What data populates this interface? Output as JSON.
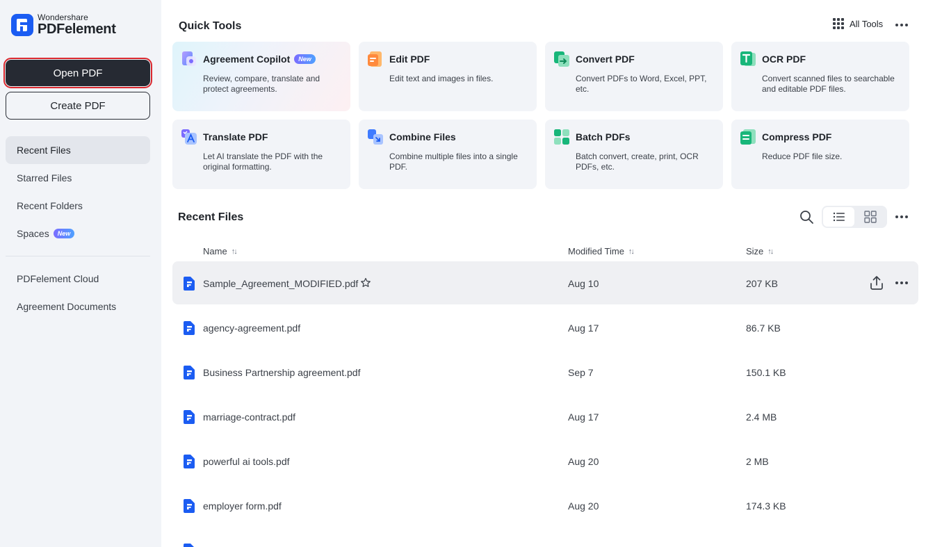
{
  "app": {
    "brand": "Wondershare",
    "product": "PDFelement"
  },
  "sidebar": {
    "open_pdf": "Open PDF",
    "create_pdf": "Create PDF",
    "items": [
      {
        "label": "Recent Files",
        "active": true
      },
      {
        "label": "Starred Files"
      },
      {
        "label": "Recent Folders"
      },
      {
        "label": "Spaces",
        "badge": "New"
      }
    ],
    "items2": [
      {
        "label": "PDFelement Cloud"
      },
      {
        "label": "Agreement Documents"
      }
    ]
  },
  "quick_tools": {
    "title": "Quick Tools",
    "all_tools": "All Tools",
    "tools": [
      {
        "name": "Agreement Copilot",
        "badge": "New",
        "desc": "Review, compare, translate and protect agreements.",
        "icon": "agreement-copilot-icon"
      },
      {
        "name": "Edit PDF",
        "desc": "Edit text and images in files.",
        "icon": "edit-pdf-icon"
      },
      {
        "name": "Convert PDF",
        "desc": "Convert PDFs to Word, Excel, PPT, etc.",
        "icon": "convert-pdf-icon"
      },
      {
        "name": "OCR PDF",
        "desc": "Convert scanned files to searchable and editable PDF files.",
        "icon": "ocr-pdf-icon"
      },
      {
        "name": "Translate PDF",
        "desc": "Let AI translate the PDF with the original formatting.",
        "icon": "translate-pdf-icon"
      },
      {
        "name": "Combine Files",
        "desc": "Combine multiple files into a single PDF.",
        "icon": "combine-files-icon"
      },
      {
        "name": "Batch PDFs",
        "desc": "Batch convert, create, print, OCR PDFs, etc.",
        "icon": "batch-pdfs-icon"
      },
      {
        "name": "Compress PDF",
        "desc": "Reduce PDF file size.",
        "icon": "compress-pdf-icon"
      }
    ]
  },
  "recent_files": {
    "title": "Recent Files",
    "columns": {
      "name": "Name",
      "modified": "Modified Time",
      "size": "Size"
    },
    "rows": [
      {
        "name": "Sample_Agreement_MODIFIED.pdf",
        "modified": "Aug 10",
        "size": "207 KB"
      },
      {
        "name": "agency-agreement.pdf",
        "modified": "Aug 17",
        "size": "86.7 KB"
      },
      {
        "name": "Business Partnership agreement.pdf",
        "modified": "Sep 7",
        "size": "150.1 KB"
      },
      {
        "name": "marriage-contract.pdf",
        "modified": "Aug 17",
        "size": "2.4 MB"
      },
      {
        "name": "powerful ai tools.pdf",
        "modified": "Aug 20",
        "size": "2 MB"
      },
      {
        "name": "employer form.pdf",
        "modified": "Aug 20",
        "size": "174.3 KB"
      }
    ]
  },
  "colors": {
    "accent": "#1b5cf2",
    "primary_button": "#262a33",
    "sidebar_bg": "#f2f4f8",
    "focus_outline": "#d9272e"
  }
}
